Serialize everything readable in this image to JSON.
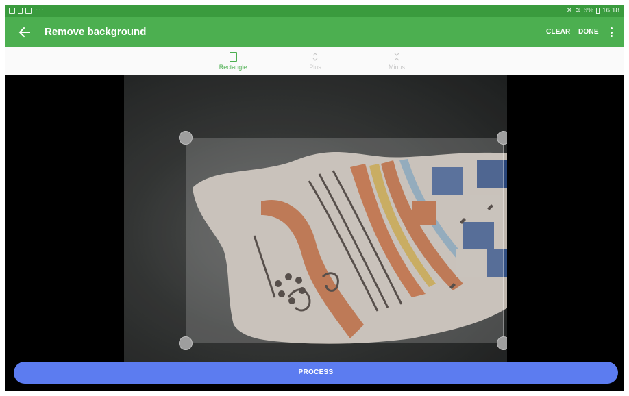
{
  "status_bar": {
    "notification_dots": "···",
    "battery": "6%",
    "time": "16:18",
    "left_icons": [
      "image-notification-icon",
      "file-notification-icon",
      "mail-notification-icon"
    ],
    "right_icons": [
      "mute-icon",
      "wifi-icon",
      "battery-icon"
    ]
  },
  "app_bar": {
    "title": "Remove background",
    "actions": {
      "clear": "CLEAR",
      "done": "DONE"
    },
    "color": "#4caf50"
  },
  "tools": {
    "rectangle": "Rectangle",
    "plus": "Plus",
    "minus": "Minus",
    "active": "rectangle",
    "active_color": "#4caf50"
  },
  "process_button": {
    "label": "PROCESS",
    "color": "#5c7cf0"
  }
}
